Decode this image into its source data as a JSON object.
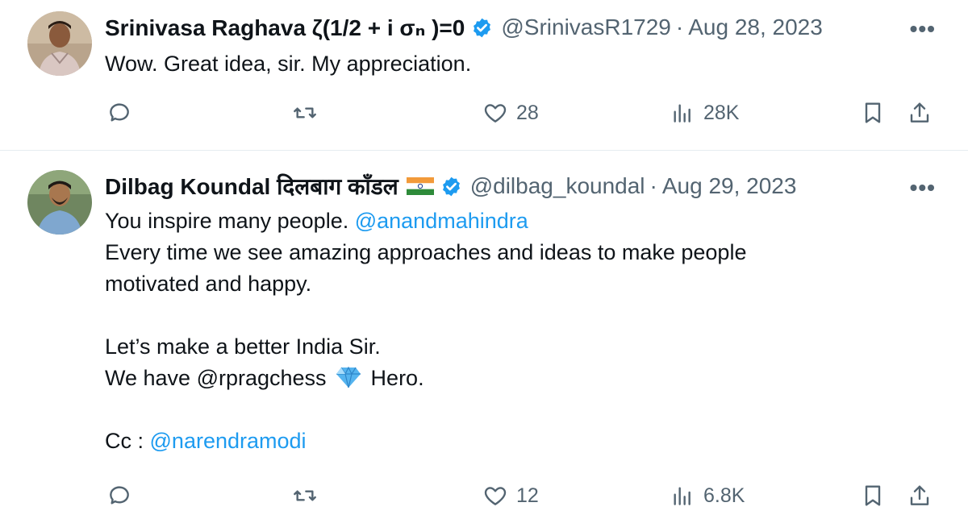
{
  "tweets": [
    {
      "name": "Srinivasa Raghava ζ(1/2 + i σₙ )=0",
      "handle": "@SrinivasR1729",
      "separator": "·",
      "date": "Aug 28, 2023",
      "more": "•••",
      "lines": [
        "Wow. Great idea, sir. My appreciation."
      ],
      "actions": {
        "reply_icon": "reply-icon",
        "retweet_icon": "retweet-icon",
        "like_icon": "heart-icon",
        "like_count": "28",
        "views_icon": "views-icon",
        "views_count": "28K",
        "bookmark_icon": "bookmark-icon",
        "share_icon": "share-icon"
      }
    },
    {
      "name": "Dilbag Koundal दिलबाग कॉंडल",
      "handle": "@dilbag_koundal",
      "separator": "·",
      "date": "Aug 29, 2023",
      "more": "•••",
      "line1_text": "You inspire many people. ",
      "line1_mention": "@anandmahindra",
      "line2": "Every time we see amazing approaches and ideas to make people",
      "line3": "motivated and happy.",
      "line4": "Let’s make a better India Sir.",
      "line5_pre": "We have @rpragchess ",
      "line5_post": " Hero.",
      "line6_text": "Cc : ",
      "line6_mention": "@narendramodi",
      "actions": {
        "reply_icon": "reply-icon",
        "retweet_icon": "retweet-icon",
        "like_icon": "heart-icon",
        "like_count": "12",
        "views_icon": "views-icon",
        "views_count": "6.8K",
        "bookmark_icon": "bookmark-icon",
        "share_icon": "share-icon"
      }
    }
  ],
  "colors": {
    "text": "#0f1419",
    "secondary": "#536471",
    "link": "#1d9bf0",
    "verified": "#1d9bf0",
    "divider": "#e6ecf0"
  }
}
